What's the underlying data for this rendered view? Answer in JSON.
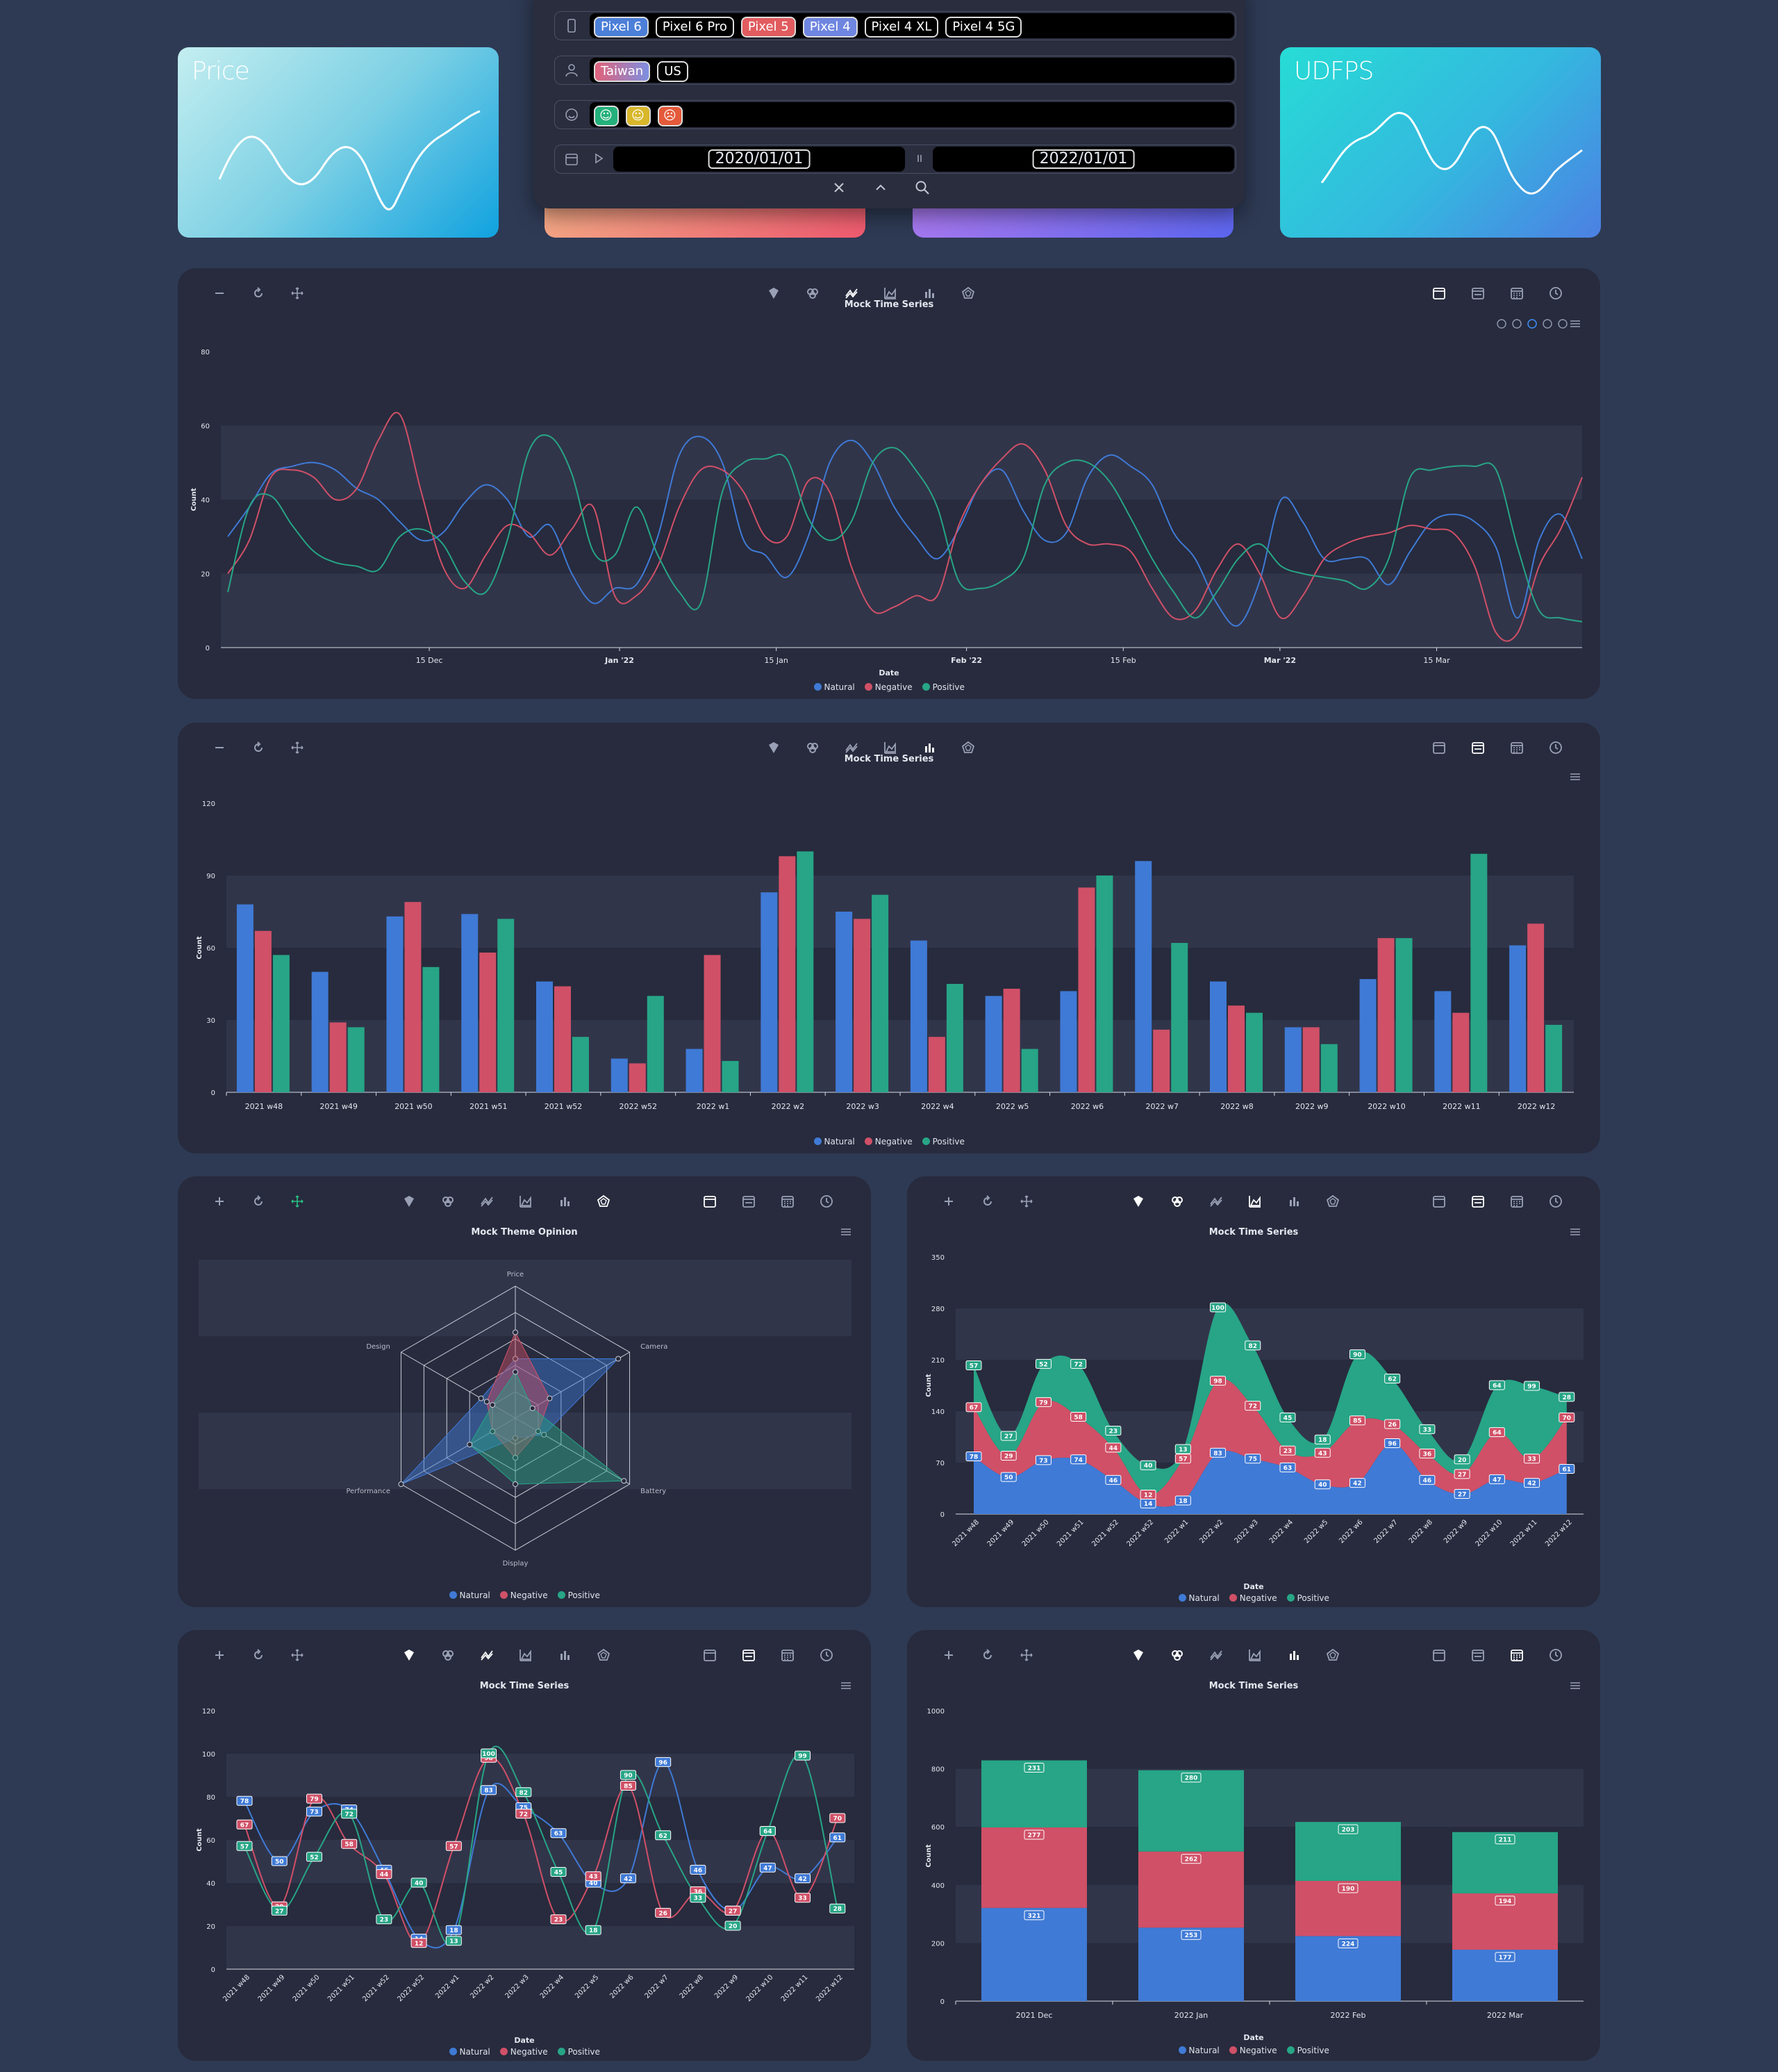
{
  "colors": {
    "natural": "#3f7ad6",
    "negative": "#d05067",
    "positive": "#27a586",
    "grid_band": "#31354a",
    "text": "#e3e7ef"
  },
  "cards": [
    {
      "title": "Price",
      "gradient": [
        "#b9ecef",
        "#10a2df"
      ]
    },
    {
      "title": "",
      "gradient": [
        "#f3a182",
        "#f0596f"
      ]
    },
    {
      "title": "",
      "gradient": [
        "#a874f0",
        "#6367f0"
      ]
    },
    {
      "title": "UDFPS",
      "gradient": [
        "#28dbd6",
        "#4b86e2"
      ]
    }
  ],
  "filter": {
    "devices": [
      "Pixel 6",
      "Pixel 6 Pro",
      "Pixel 5",
      "Pixel 4",
      "Pixel 4 XL",
      "Pixel 4 5G"
    ],
    "device_chip_colors": [
      "#4c7fd8",
      "",
      "#e15c5f",
      "#6f86e0",
      "",
      ""
    ],
    "regions": [
      "Taiwan",
      "US"
    ],
    "sentiments": [
      "positive-face-icon",
      "neutral-face-icon",
      "negative-face-icon"
    ],
    "sentiment_colors": [
      "#24b07a",
      "#d8b72a",
      "#e45a3a"
    ],
    "date_from": "2020/01/01",
    "date_to": "2022/01/01"
  },
  "legend": [
    "Natural",
    "Negative",
    "Positive"
  ],
  "charts": {
    "timeseries": {
      "title": "Mock Time Series",
      "xlabel": "Date",
      "ylabel": "Count"
    },
    "bar": {
      "title": "Mock Time Series",
      "xlabel": "",
      "ylabel": "Count"
    },
    "radar": {
      "title": "Mock Theme Opinion"
    },
    "area": {
      "title": "Mock Time Series",
      "xlabel": "Date",
      "ylabel": "Count"
    },
    "line": {
      "title": "Mock Time Series",
      "xlabel": "Date",
      "ylabel": "Count"
    },
    "stack": {
      "title": "Mock Time Series",
      "xlabel": "Date",
      "ylabel": "Count"
    }
  },
  "chart_data": [
    {
      "type": "line",
      "title": "Mock Time Series",
      "xlabel": "Date",
      "ylabel": "Count",
      "ylim": [
        0,
        80
      ],
      "yticks": [
        0,
        20,
        40,
        60,
        80
      ],
      "xticks": [
        "15 Dec",
        "Jan '22",
        "15 Jan",
        "Feb '22",
        "15 Feb",
        "Mar '22",
        "15 Mar"
      ],
      "x_start": "2021-11-27",
      "x_end": "2022-03-28",
      "series": [
        {
          "name": "Natural",
          "values": [
            30,
            38,
            47,
            49,
            50,
            48,
            43,
            40,
            34,
            29,
            31,
            39,
            44,
            40,
            30,
            33,
            20,
            12,
            16,
            17,
            30,
            52,
            57,
            50,
            29,
            25,
            19,
            30,
            50,
            56,
            50,
            38,
            30,
            24,
            32,
            44,
            48,
            37,
            29,
            31,
            46,
            52,
            49,
            44,
            31,
            24,
            12,
            6,
            18,
            40,
            34,
            24,
            24,
            24,
            17,
            26,
            34,
            36,
            34,
            27,
            8,
            29,
            36,
            24
          ],
          "sample": "every 2 days"
        },
        {
          "name": "Negative",
          "values": [
            20,
            29,
            46,
            48,
            46,
            40,
            43,
            56,
            63,
            42,
            22,
            16,
            25,
            33,
            31,
            25,
            32,
            38,
            14,
            14,
            22,
            38,
            48,
            48,
            42,
            30,
            30,
            45,
            42,
            22,
            10,
            11,
            14,
            14,
            33,
            44,
            51,
            55,
            48,
            33,
            28,
            28,
            26,
            16,
            8,
            10,
            21,
            28,
            20,
            8,
            14,
            24,
            28,
            30,
            31,
            33,
            32,
            31,
            22,
            4,
            4,
            22,
            32,
            46
          ],
          "sample": "every 2 days"
        },
        {
          "name": "Positive",
          "values": [
            15,
            38,
            41,
            33,
            26,
            23,
            22,
            21,
            30,
            32,
            28,
            18,
            15,
            29,
            53,
            57,
            47,
            26,
            25,
            38,
            25,
            15,
            12,
            42,
            50,
            51,
            51,
            35,
            29,
            34,
            50,
            54,
            48,
            38,
            18,
            16,
            18,
            24,
            44,
            50,
            50,
            45,
            35,
            24,
            15,
            8,
            15,
            24,
            28,
            22,
            20,
            19,
            18,
            16,
            24,
            46,
            48,
            49,
            49,
            48,
            27,
            10,
            8,
            7
          ],
          "sample": "every 2 days"
        }
      ]
    },
    {
      "type": "bar",
      "title": "Mock Time Series",
      "ylabel": "Count",
      "ylim": [
        0,
        120
      ],
      "yticks": [
        0,
        30,
        60,
        90,
        120
      ],
      "categories": [
        "2021 w48",
        "2021 w49",
        "2021 w50",
        "2021 w51",
        "2021 w52",
        "2022 w52",
        "2022 w1",
        "2022 w2",
        "2022 w3",
        "2022 w4",
        "2022 w5",
        "2022 w6",
        "2022 w7",
        "2022 w8",
        "2022 w9",
        "2022 w10",
        "2022 w11",
        "2022 w12"
      ],
      "series": [
        {
          "name": "Natural",
          "values": [
            78,
            50,
            73,
            74,
            46,
            14,
            18,
            83,
            75,
            63,
            40,
            42,
            96,
            46,
            27,
            47,
            42,
            61
          ]
        },
        {
          "name": "Negative",
          "values": [
            67,
            29,
            79,
            58,
            44,
            12,
            57,
            98,
            72,
            23,
            43,
            85,
            26,
            36,
            27,
            64,
            33,
            70
          ]
        },
        {
          "name": "Positive",
          "values": [
            57,
            27,
            52,
            72,
            23,
            40,
            13,
            100,
            82,
            45,
            18,
            90,
            62,
            33,
            20,
            64,
            99,
            28
          ]
        }
      ]
    },
    {
      "type": "radar",
      "title": "Mock Theme Opinion",
      "axes": [
        "Price",
        "Camera",
        "Battery",
        "Display",
        "Performance",
        "Design"
      ],
      "rmax": 20,
      "rings": [
        4,
        8,
        12,
        16,
        20
      ],
      "series": [
        {
          "name": "Natural",
          "values": [
            9,
            18,
            5,
            3,
            20,
            6
          ]
        },
        {
          "name": "Negative",
          "values": [
            13,
            6,
            4,
            6,
            4,
            5
          ]
        },
        {
          "name": "Positive",
          "values": [
            7,
            3,
            19,
            10,
            8,
            4
          ]
        }
      ]
    },
    {
      "type": "area",
      "stacked": true,
      "title": "Mock Time Series",
      "xlabel": "Date",
      "ylabel": "Count",
      "ylim": [
        0,
        350
      ],
      "yticks": [
        0,
        70,
        140,
        210,
        280,
        350
      ],
      "categories": [
        "2021 w48",
        "2021 w49",
        "2021 w50",
        "2021 w51",
        "2021 w52",
        "2022 w52",
        "2022 w1",
        "2022 w2",
        "2022 w3",
        "2022 w4",
        "2022 w5",
        "2022 w6",
        "2022 w7",
        "2022 w8",
        "2022 w9",
        "2022 w10",
        "2022 w11",
        "2022 w12"
      ],
      "series": [
        {
          "name": "Natural",
          "values": [
            78,
            50,
            73,
            74,
            46,
            14,
            18,
            83,
            75,
            63,
            40,
            42,
            96,
            46,
            27,
            47,
            42,
            61
          ]
        },
        {
          "name": "Negative",
          "values": [
            67,
            29,
            79,
            58,
            44,
            12,
            57,
            98,
            72,
            23,
            43,
            85,
            26,
            36,
            27,
            64,
            33,
            70
          ]
        },
        {
          "name": "Positive",
          "values": [
            57,
            27,
            52,
            72,
            23,
            40,
            13,
            100,
            82,
            45,
            18,
            90,
            62,
            33,
            20,
            64,
            99,
            28
          ]
        }
      ]
    },
    {
      "type": "line",
      "title": "Mock Time Series",
      "xlabel": "Date",
      "ylabel": "Count",
      "ylim": [
        0,
        120
      ],
      "yticks": [
        0,
        20,
        40,
        60,
        80,
        100,
        120
      ],
      "categories": [
        "2021 w48",
        "2021 w49",
        "2021 w50",
        "2021 w51",
        "2021 w52",
        "2022 w52",
        "2022 w1",
        "2022 w2",
        "2022 w3",
        "2022 w4",
        "2022 w5",
        "2022 w6",
        "2022 w7",
        "2022 w8",
        "2022 w9",
        "2022 w10",
        "2022 w11",
        "2022 w12"
      ],
      "series": [
        {
          "name": "Natural",
          "values": [
            78,
            50,
            73,
            74,
            46,
            14,
            18,
            83,
            75,
            63,
            40,
            42,
            96,
            46,
            27,
            47,
            42,
            61
          ]
        },
        {
          "name": "Negative",
          "values": [
            67,
            29,
            79,
            58,
            44,
            12,
            57,
            98,
            72,
            23,
            43,
            85,
            26,
            36,
            27,
            64,
            33,
            70
          ]
        },
        {
          "name": "Positive",
          "values": [
            57,
            27,
            52,
            72,
            23,
            40,
            13,
            100,
            82,
            45,
            18,
            90,
            62,
            33,
            20,
            64,
            99,
            28
          ]
        }
      ]
    },
    {
      "type": "bar",
      "stacked": true,
      "title": "Mock Time Series",
      "xlabel": "Date",
      "ylabel": "Count",
      "ylim": [
        0,
        1000
      ],
      "yticks": [
        0,
        200,
        400,
        600,
        800,
        1000
      ],
      "categories": [
        "2021 Dec",
        "2022 Jan",
        "2022 Feb",
        "2022 Mar"
      ],
      "series": [
        {
          "name": "Natural",
          "values": [
            321,
            253,
            224,
            177
          ]
        },
        {
          "name": "Negative",
          "values": [
            277,
            262,
            190,
            194
          ]
        },
        {
          "name": "Positive",
          "values": [
            231,
            280,
            203,
            211
          ]
        }
      ]
    }
  ]
}
